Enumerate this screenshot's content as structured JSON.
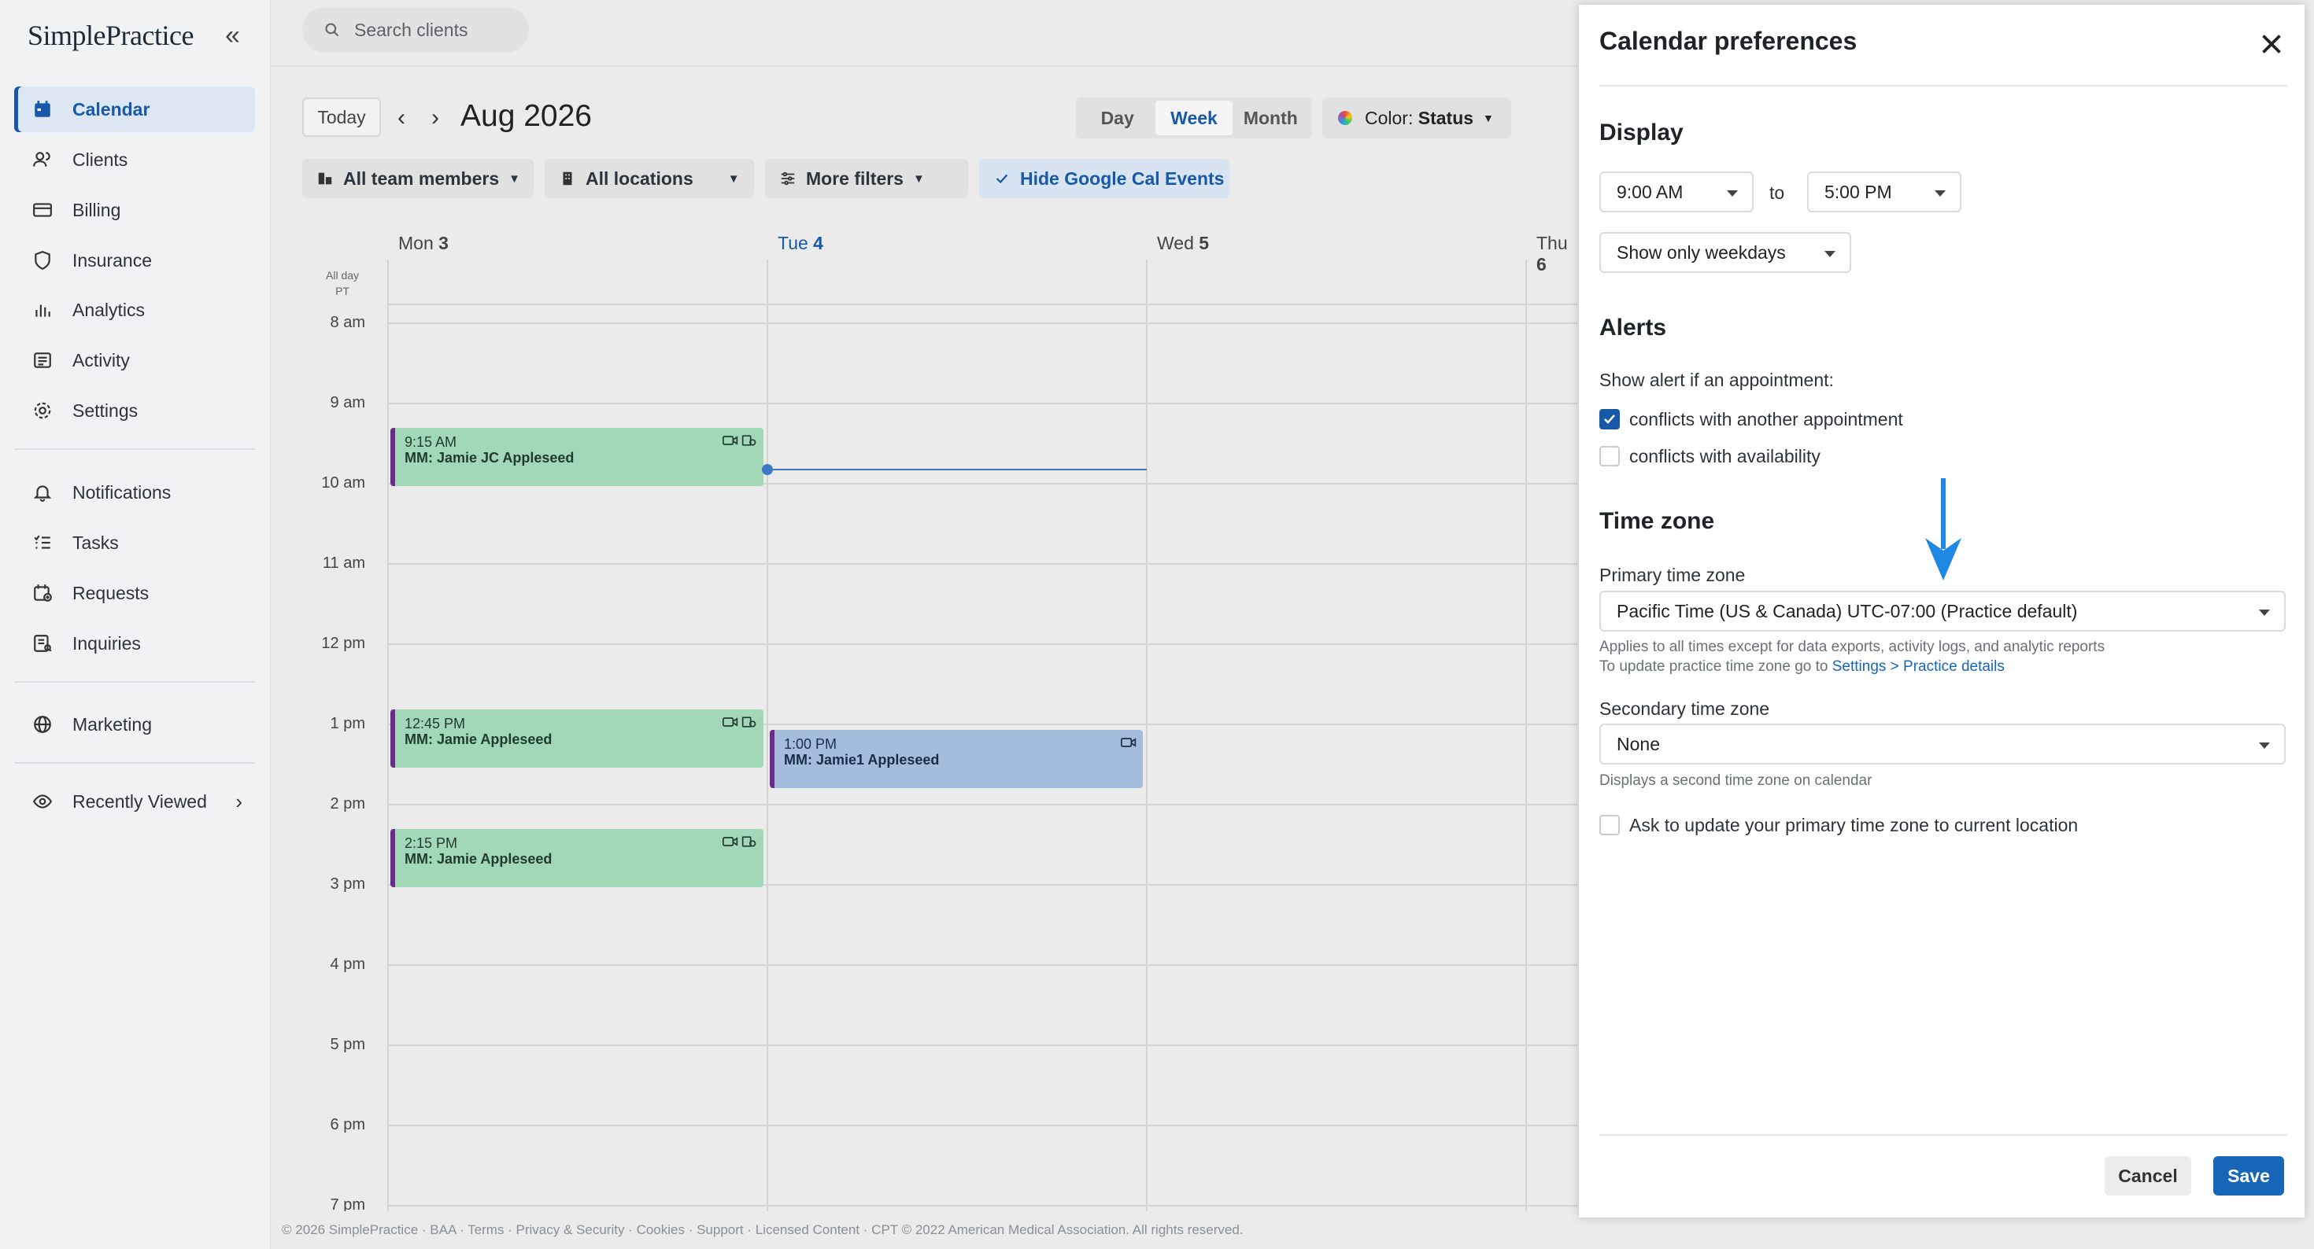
{
  "app": {
    "logo": "SimplePractice"
  },
  "sidebar": {
    "items": [
      {
        "label": "Calendar",
        "icon": "calendar-icon",
        "active": true
      },
      {
        "label": "Clients",
        "icon": "clients-icon"
      },
      {
        "label": "Billing",
        "icon": "billing-icon"
      },
      {
        "label": "Insurance",
        "icon": "shield-icon"
      },
      {
        "label": "Analytics",
        "icon": "analytics-icon"
      },
      {
        "label": "Activity",
        "icon": "activity-icon"
      },
      {
        "label": "Settings",
        "icon": "gear-icon"
      },
      {
        "label": "Notifications",
        "icon": "bell-icon"
      },
      {
        "label": "Tasks",
        "icon": "tasks-icon"
      },
      {
        "label": "Requests",
        "icon": "requests-icon"
      },
      {
        "label": "Inquiries",
        "icon": "inquiries-icon"
      },
      {
        "label": "Marketing",
        "icon": "globe-icon"
      },
      {
        "label": "Recently Viewed",
        "icon": "eye-icon"
      }
    ]
  },
  "search": {
    "placeholder": "Search clients"
  },
  "toolbar": {
    "today": "Today",
    "month_title": "Aug 2026",
    "views": [
      "Day",
      "Week",
      "Month"
    ],
    "active_view": "Week",
    "color_label": "Color:",
    "color_value": "Status",
    "filters": {
      "team": "All team members",
      "locations": "All locations",
      "more": "More filters",
      "google": "Hide Google Cal Events"
    }
  },
  "calendar": {
    "days": [
      {
        "name": "Mon",
        "num": "3",
        "today": false
      },
      {
        "name": "Tue",
        "num": "4",
        "today": true
      },
      {
        "name": "Wed",
        "num": "5",
        "today": false
      },
      {
        "name": "Thu",
        "num": "6",
        "today": false
      }
    ],
    "allday_label": "All day",
    "tz_label": "PT",
    "hours": [
      "8 am",
      "9 am",
      "10 am",
      "11 am",
      "12 pm",
      "1 pm",
      "2 pm",
      "3 pm",
      "4 pm",
      "5 pm",
      "6 pm",
      "7 pm"
    ],
    "events": [
      {
        "time": "9:15 AM",
        "name": "MM: Jamie JC Appleseed",
        "color": "#a2d7b8"
      },
      {
        "time": "12:45 PM",
        "name": "MM: Jamie Appleseed",
        "color": "#a2d7b8"
      },
      {
        "time": "2:15 PM",
        "name": "MM: Jamie Appleseed",
        "color": "#a2d7b8"
      },
      {
        "time": "1:00 PM",
        "name": "MM: Jamie1 Appleseed",
        "color": "#a4bddd"
      }
    ]
  },
  "footer": "© 2026 SimplePractice · BAA · Terms · Privacy & Security · Cookies · Support · Licensed Content · CPT © 2022 American Medical Association. All rights reserved.",
  "drawer": {
    "title": "Calendar preferences",
    "display": {
      "heading": "Display",
      "from": "9:00 AM",
      "to_label": "to",
      "to": "5:00 PM",
      "days": "Show only weekdays"
    },
    "alerts": {
      "heading": "Alerts",
      "intro": "Show alert if an appointment:",
      "conflicts_appt": "conflicts with another appointment",
      "conflicts_appt_checked": true,
      "conflicts_avail": "conflicts with availability",
      "conflicts_avail_checked": false
    },
    "timezone": {
      "heading": "Time zone",
      "primary_label": "Primary time zone",
      "primary_value": "Pacific Time (US & Canada) UTC-07:00 (Practice default)",
      "help1": "Applies to all times except for data exports, activity logs, and analytic reports",
      "help2_prefix": "To update practice time zone go to ",
      "help2_link": "Settings > Practice details",
      "secondary_label": "Secondary time zone",
      "secondary_value": "None",
      "secondary_help": "Displays a second time zone on calendar",
      "ask_update": "Ask to update your primary time zone to current location",
      "ask_update_checked": false
    },
    "cancel": "Cancel",
    "save": "Save"
  },
  "colors": {
    "accent": "#1759a6",
    "save": "#1766b8",
    "event_green": "#a2d7b8",
    "event_blue": "#a4bddd",
    "annotation_arrow": "#1e88e5"
  }
}
